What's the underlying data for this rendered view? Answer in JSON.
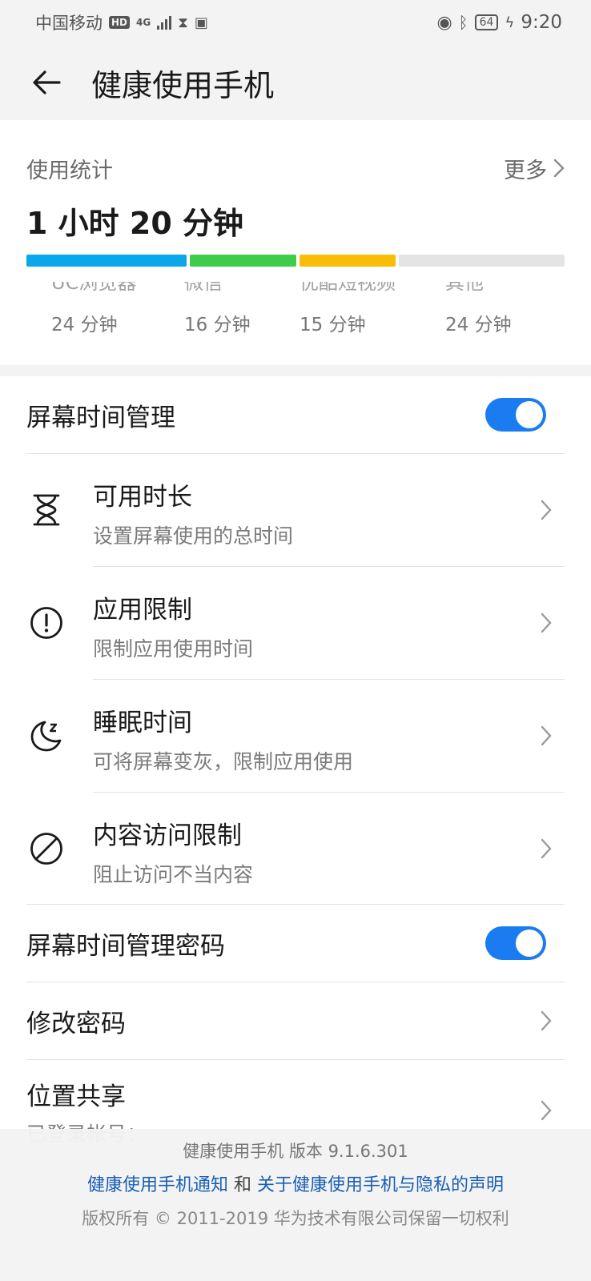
{
  "status_bar": {
    "carrier": "中国移动",
    "hd": "HD",
    "network": "4G",
    "battery": "64",
    "time": "9:20"
  },
  "app_bar": {
    "title": "健康使用手机"
  },
  "stats": {
    "label": "使用统计",
    "more": "更多",
    "total": "1 小时 20 分钟",
    "segments": [
      {
        "name": "UC浏览器",
        "minutes": "24 分钟",
        "value": 24,
        "color": "#0aa7ea"
      },
      {
        "name": "微信",
        "minutes": "16 分钟",
        "value": 16,
        "color": "#3fcc4a"
      },
      {
        "name": "优酷短视频",
        "minutes": "15 分钟",
        "value": 15,
        "color": "#fbbc05"
      },
      {
        "name": "其他",
        "minutes": "24 分钟",
        "value": 24,
        "color": "#e4e4e4"
      }
    ]
  },
  "settings": {
    "screen_time": {
      "label": "屏幕时间管理",
      "enabled": true
    },
    "items": [
      {
        "title": "可用时长",
        "subtitle": "设置屏幕使用的总时间",
        "icon": "hourglass-icon"
      },
      {
        "title": "应用限制",
        "subtitle": "限制应用使用时间",
        "icon": "alert-circle-icon"
      },
      {
        "title": "睡眠时间",
        "subtitle": "可将屏幕变灰，限制应用使用",
        "icon": "moon-icon"
      },
      {
        "title": "内容访问限制",
        "subtitle": "阻止访问不当内容",
        "icon": "block-icon"
      }
    ],
    "password": {
      "label": "屏幕时间管理密码",
      "enabled": true
    },
    "change_password": "修改密码",
    "location_share": {
      "title": "位置共享",
      "subtitle": "已登录帐号："
    }
  },
  "footer": {
    "version": "健康使用手机 版本 9.1.6.301",
    "link1": "健康使用手机通知",
    "and": "和",
    "link2": "关于健康使用手机与隐私的声明",
    "copyright": "版权所有 © 2011-2019 华为技术有限公司保留一切权利"
  }
}
